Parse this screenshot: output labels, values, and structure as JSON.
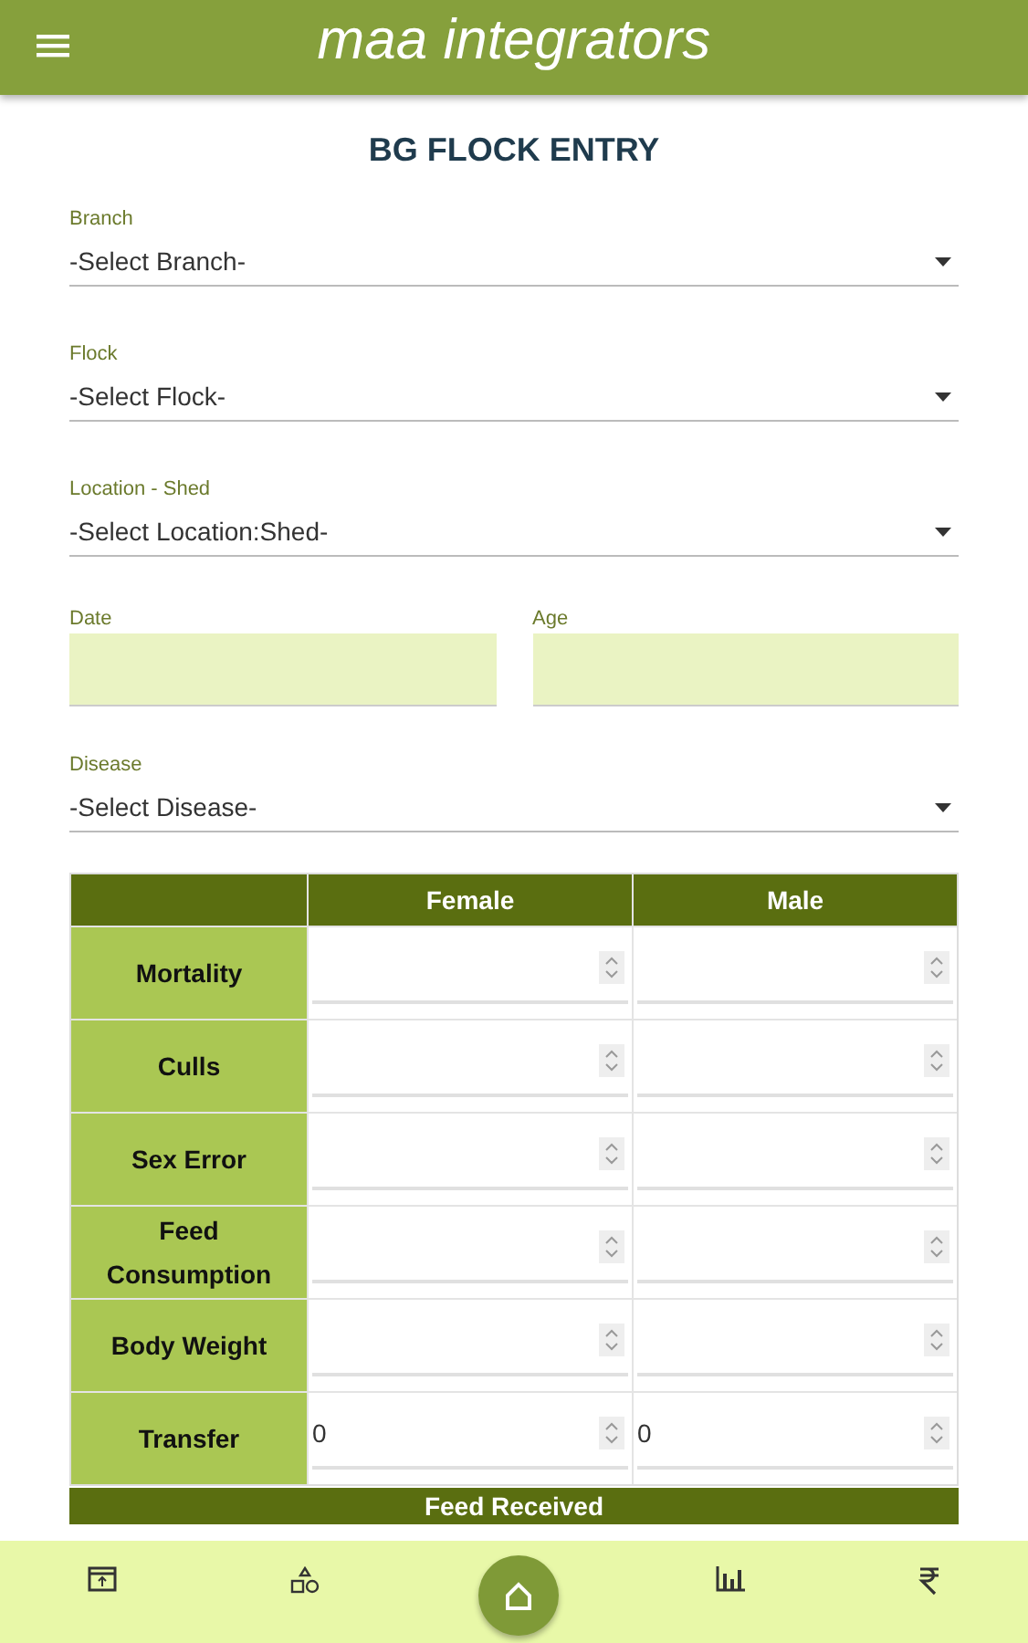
{
  "app_bar": {
    "title": "maa integrators"
  },
  "page_title": "BG FLOCK ENTRY",
  "selects_top": [
    {
      "label": "Branch",
      "value": "-Select Branch-"
    },
    {
      "label": "Flock",
      "value": "-Select Flock-"
    },
    {
      "label": "Location - Shed",
      "value": "-Select Location:Shed-"
    }
  ],
  "date_age": [
    {
      "label": "Date"
    },
    {
      "label": "Age"
    }
  ],
  "selects_bottom": [
    {
      "label": "Disease",
      "value": "-Select Disease-"
    }
  ],
  "table": {
    "columns": [
      "Female",
      "Male"
    ],
    "rows": [
      {
        "label": "Mortality"
      },
      {
        "label": "Culls"
      },
      {
        "label": "Sex Error"
      },
      {
        "label": "Feed Consumption"
      },
      {
        "label": "Body Weight"
      },
      {
        "label": "Transfer",
        "values": [
          "0",
          "0"
        ]
      }
    ]
  },
  "section_header": "Feed Received",
  "bottom_nav": [
    {
      "kind": "screen",
      "selected": false
    },
    {
      "kind": "shapes",
      "selected": false
    },
    {
      "kind": "home",
      "selected": true
    },
    {
      "kind": "chart",
      "selected": false
    },
    {
      "kind": "rupee",
      "selected": false
    }
  ]
}
